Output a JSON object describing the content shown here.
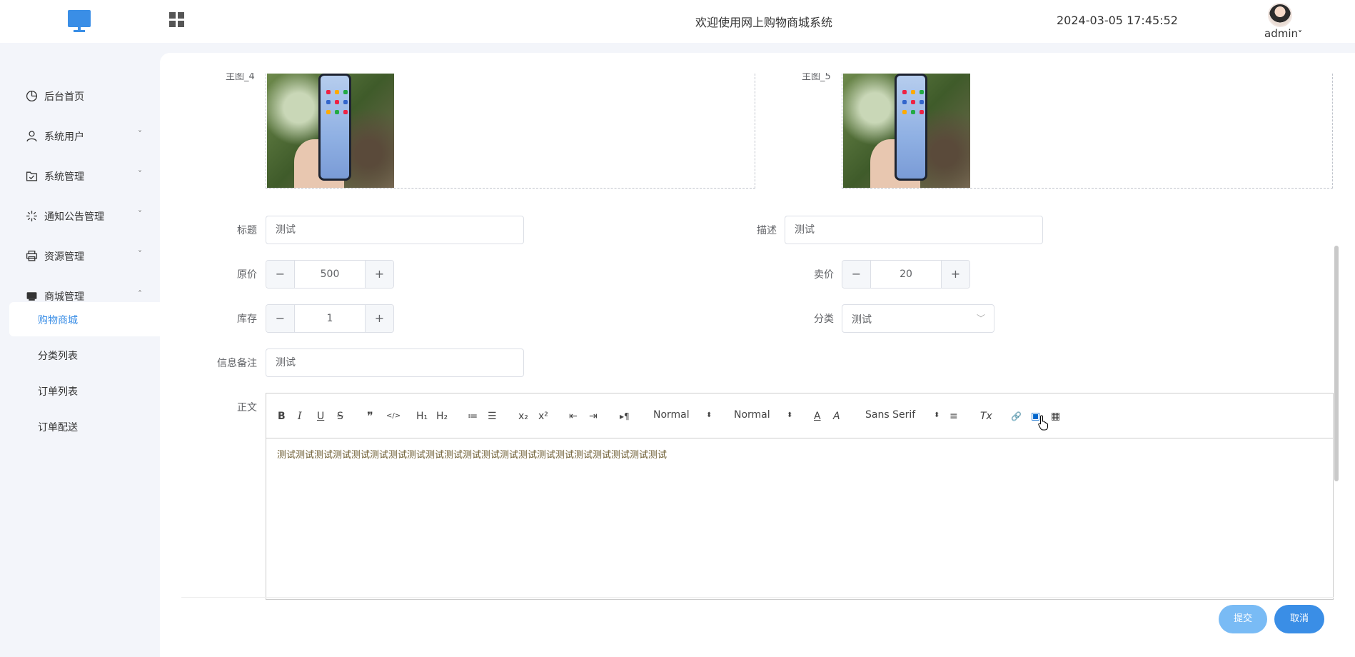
{
  "header": {
    "title": "欢迎使用网上购物商城系统",
    "datetime": "2024-03-05 17:45:52",
    "user": "admin",
    "user_caret": "˅"
  },
  "sidebar": {
    "items": [
      {
        "label": "后台首页",
        "icon": "pie-chart-icon"
      },
      {
        "label": "系统用户",
        "icon": "user-icon",
        "chevron": "˅"
      },
      {
        "label": "系统管理",
        "icon": "folder-check-icon",
        "chevron": "˅"
      },
      {
        "label": "通知公告管理",
        "icon": "sparkle-icon",
        "chevron": "˅"
      },
      {
        "label": "资源管理",
        "icon": "printer-icon",
        "chevron": "˅"
      },
      {
        "label": "商城管理",
        "icon": "shop-icon",
        "chevron": "˄"
      }
    ],
    "sub_items": [
      {
        "label": "购物商城",
        "active": true
      },
      {
        "label": "分类列表"
      },
      {
        "label": "订单列表"
      },
      {
        "label": "订单配送"
      }
    ]
  },
  "form": {
    "image_left_label": "主图_4",
    "image_right_label": "主图_5",
    "title_label": "标题",
    "title_value": "测试",
    "desc_label": "描述",
    "desc_value": "测试",
    "original_price_label": "原价",
    "original_price": "500",
    "sale_price_label": "卖价",
    "sale_price": "20",
    "stock_label": "库存",
    "stock": "1",
    "category_label": "分类",
    "category_value": "测试",
    "remark_label": "信息备注",
    "remark_value": "测试",
    "body_label": "正文",
    "minus": "−",
    "plus": "+",
    "select_arrow": "﹀"
  },
  "editor": {
    "bold": "B",
    "italic": "I",
    "underline": "U",
    "strike": "S",
    "blockquote": "❞",
    "code": "</>",
    "h1": "H₁",
    "h2": "H₂",
    "ordered_list": "≔",
    "bullet_list": "☰",
    "subscript": "x₂",
    "superscript": "x²",
    "outdent": "⇤",
    "indent": "⇥",
    "rtl": "▸¶",
    "size_select": "Normal",
    "header_select": "Normal",
    "font_color": "A",
    "bg_color": "A",
    "font_select": "Sans Serif",
    "align": "≡",
    "clean": "Tx",
    "link": "🔗",
    "image": "▣",
    "video": "▦",
    "updown": "⬍",
    "content": "测试测试测试测试测试测试测试测试测试测试测试测试测试测试测试测试测试测试测试测试测试"
  },
  "actions": {
    "submit": "提交",
    "cancel": "取消"
  },
  "colors": {
    "accent": "#3a8ee6",
    "submit_bg": "#79bbf5",
    "page_bg": "#f3f5fa"
  }
}
